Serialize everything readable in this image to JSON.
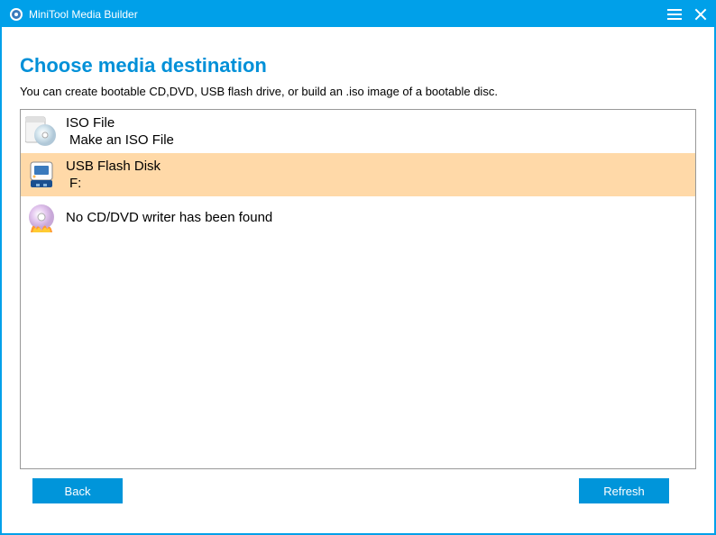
{
  "window": {
    "title": "MiniTool Media Builder"
  },
  "page": {
    "title": "Choose media destination",
    "subtitle": "You can create bootable CD,DVD, USB flash drive, or build an .iso image of a bootable disc."
  },
  "options": [
    {
      "title": "ISO File",
      "subtitle": "Make an ISO File",
      "icon": "disc-iso-icon",
      "selected": false
    },
    {
      "title": "USB Flash Disk",
      "subtitle": "F:",
      "icon": "usb-icon",
      "selected": true
    },
    {
      "title": "No CD/DVD writer has been found",
      "subtitle": "",
      "icon": "dvd-fire-icon",
      "selected": false
    }
  ],
  "buttons": {
    "back": "Back",
    "refresh": "Refresh"
  }
}
